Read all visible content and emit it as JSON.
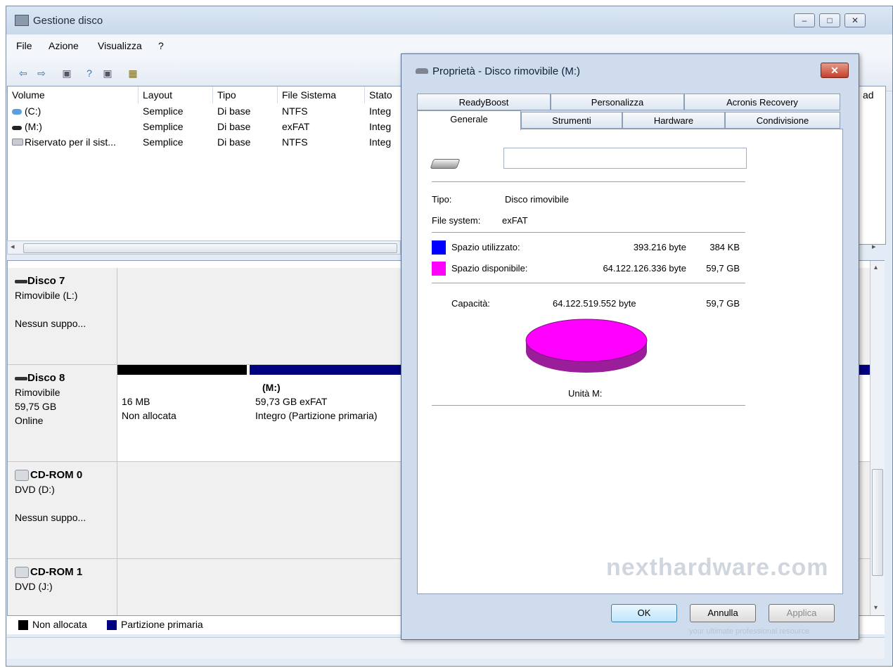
{
  "window": {
    "title": "Gestione disco",
    "controls": [
      "–",
      "□",
      "✕"
    ]
  },
  "menu": [
    "File",
    "Azione",
    "Visualizza",
    "?"
  ],
  "volume_list": {
    "columns": [
      "Volume",
      "Layout",
      "Tipo",
      "File Sistema",
      "Stato"
    ],
    "right_column_fragment": "ad",
    "rows": [
      [
        "(C:)",
        "Semplice",
        "Di base",
        "NTFS",
        "Integ"
      ],
      [
        "(M:)",
        "Semplice",
        "Di base",
        "exFAT",
        "Integ"
      ],
      [
        "Riservato per il sist...",
        "Semplice",
        "Di base",
        "NTFS",
        "Integ"
      ]
    ]
  },
  "disks": [
    {
      "name": "Disco 7",
      "lines": [
        "Rimovibile (L:)",
        "",
        "Nessun suppo..."
      ]
    },
    {
      "name": "Disco 8",
      "lines": [
        "Rimovibile",
        "59,75 GB",
        "Online"
      ],
      "partitions": [
        {
          "size": "16 MB",
          "status": "Non allocata"
        },
        {
          "name": "(M:)",
          "size": "59,73 GB exFAT",
          "status": "Integro (Partizione primaria)"
        }
      ]
    },
    {
      "name": "CD-ROM 0",
      "lines": [
        "DVD (D:)",
        "",
        "Nessun suppo..."
      ]
    },
    {
      "name": "CD-ROM 1",
      "lines": [
        "DVD (J:)"
      ]
    }
  ],
  "legend": [
    "Non allocata",
    "Partizione primaria"
  ],
  "dialog": {
    "title": "Proprietà - Disco rimovibile (M:)",
    "close": "✕",
    "tabs_row1": [
      "ReadyBoost",
      "Personalizza",
      "Acronis Recovery"
    ],
    "tabs_row2": [
      "Generale",
      "Strumenti",
      "Hardware",
      "Condivisione"
    ],
    "name_value": "",
    "type_label": "Tipo:",
    "type_value": "Disco rimovibile",
    "fs_label": "File system:",
    "fs_value": "exFAT",
    "used_label": "Spazio utilizzato:",
    "used_bytes": "393.216 byte",
    "used_size": "384 KB",
    "free_label": "Spazio disponibile:",
    "free_bytes": "64.122.126.336 byte",
    "free_size": "59,7 GB",
    "cap_label": "Capacità:",
    "cap_bytes": "64.122.519.552 byte",
    "cap_size": "59,7 GB",
    "drive_label": "Unità M:",
    "buttons": [
      "OK",
      "Annulla",
      "Applica"
    ]
  },
  "watermark": {
    "main": "nexthardware.com",
    "sub": "your ultimate professional resource"
  },
  "colors": {
    "used": "#0000ff",
    "free": "#ff00ff",
    "unallocated": "#000000",
    "primary": "#000080"
  }
}
